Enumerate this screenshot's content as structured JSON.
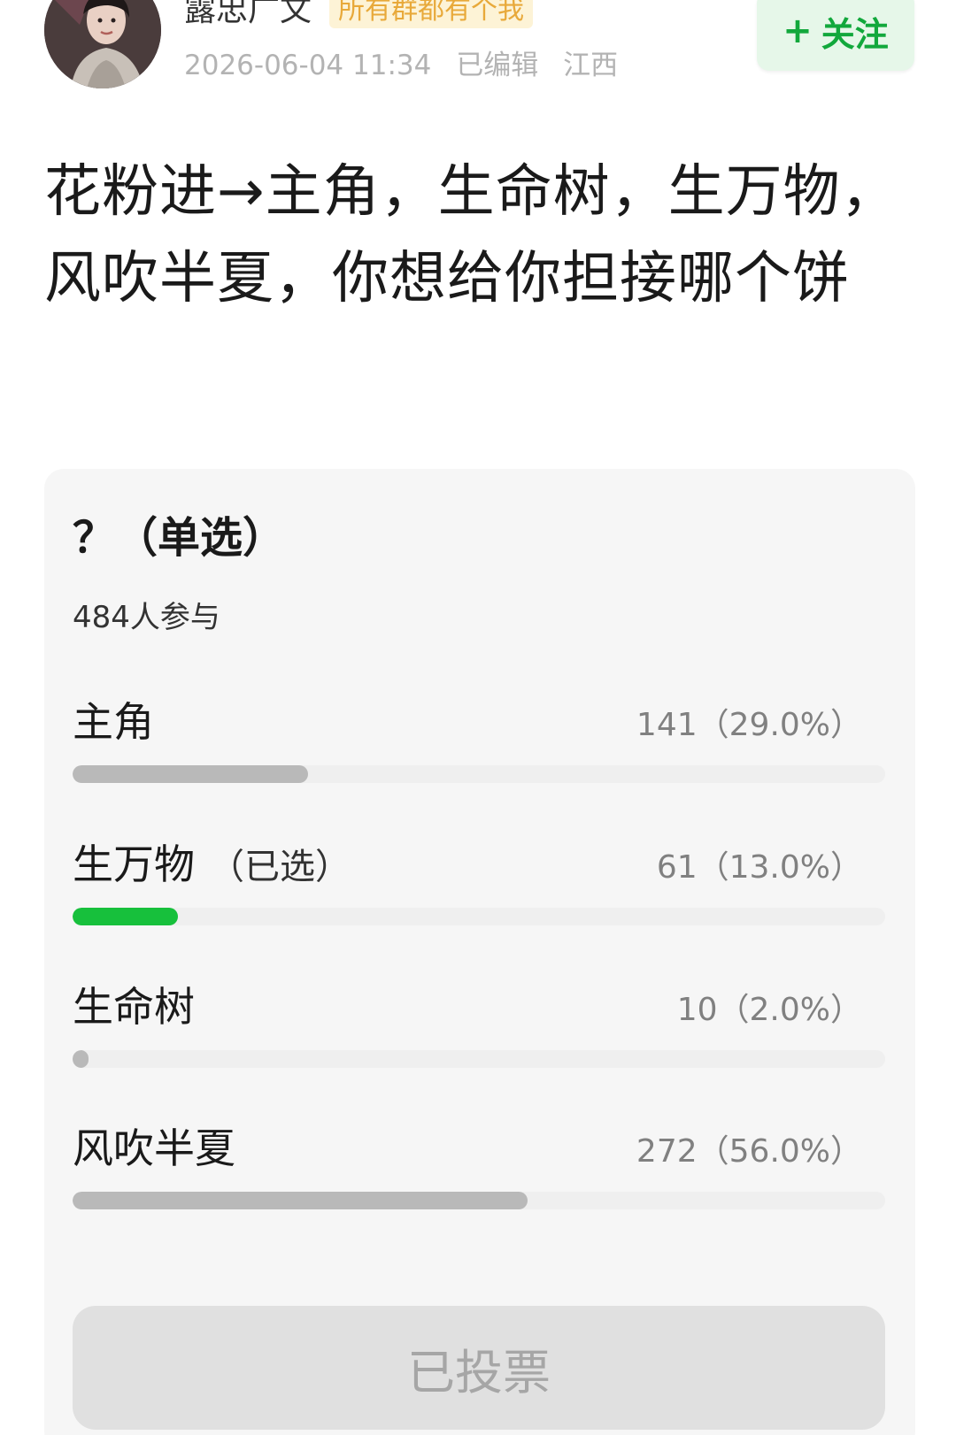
{
  "header": {
    "author_name": "露忠广文",
    "author_badge": "所有群都有个我",
    "timestamp": "2026-06-04 11:34",
    "edited": "已编辑",
    "location": "江西",
    "follow_plus": "+",
    "follow_label": "关注"
  },
  "colors": {
    "follow_text": "#12a83c",
    "follow_bg": "#e6f7e9",
    "selected_bar": "#17c03c",
    "other_bar": "#b9b9b9",
    "badge_text": "#e8a93a"
  },
  "post": {
    "text": "花粉进→主角，生命树，生万物，风吹半夏，你想给你担接哪个饼"
  },
  "poll": {
    "title": "？（单选）",
    "participants": "484人参与",
    "options": [
      {
        "label": "主角",
        "selected_tag": "",
        "result": "141（29.0%）",
        "fraction": 0.29,
        "mine": false
      },
      {
        "label": "生万物",
        "selected_tag": "（已选）",
        "result": "61（13.0%）",
        "fraction": 0.13,
        "mine": true
      },
      {
        "label": "生命树",
        "selected_tag": "",
        "result": "10（2.0%）",
        "fraction": 0.02,
        "mine": false
      },
      {
        "label": "风吹半夏",
        "selected_tag": "",
        "result": "272（56.0%）",
        "fraction": 0.56,
        "mine": false
      }
    ],
    "voted_label": "已投票"
  }
}
